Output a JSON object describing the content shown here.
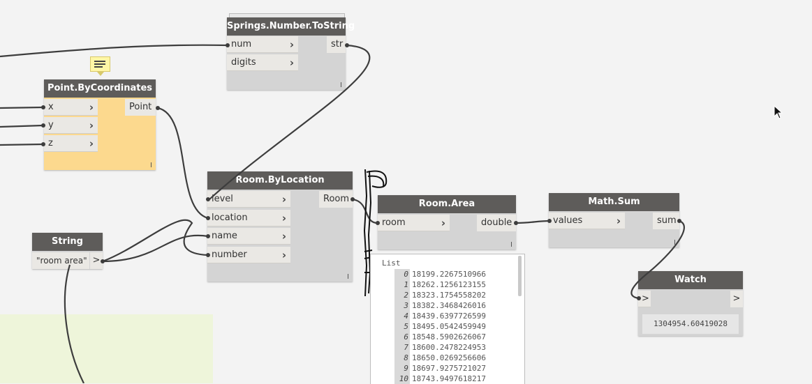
{
  "nodes": {
    "point": {
      "title": "Point.ByCoordinates",
      "inputs": [
        "x",
        "y",
        "z"
      ],
      "output": "Point"
    },
    "springs": {
      "title": "Springs.Number.ToString",
      "inputs": [
        "num",
        "digits"
      ],
      "output": "str"
    },
    "room_by_location": {
      "title": "Room.ByLocation",
      "inputs": [
        "level",
        "location",
        "name",
        "number"
      ],
      "output": "Room"
    },
    "string": {
      "title": "String",
      "value": "\"room area\"",
      "out_chevron": ">"
    },
    "room_area": {
      "title": "Room.Area",
      "input": "room",
      "output": "double"
    },
    "math_sum": {
      "title": "Math.Sum",
      "input": "values",
      "output": "sum"
    },
    "watch": {
      "title": "Watch",
      "in_chevron": ">",
      "out_chevron": ">",
      "value": "1304954.60419028"
    }
  },
  "preview": {
    "title": "List",
    "items": [
      {
        "index": "0",
        "value": "18199.2267510966"
      },
      {
        "index": "1",
        "value": "18262.1256123155"
      },
      {
        "index": "2",
        "value": "18323.1754558202"
      },
      {
        "index": "3",
        "value": "18382.3468426016"
      },
      {
        "index": "4",
        "value": "18439.6397726599"
      },
      {
        "index": "5",
        "value": "18495.0542459949"
      },
      {
        "index": "6",
        "value": "18548.5902626067"
      },
      {
        "index": "7",
        "value": "18600.2478224953"
      },
      {
        "index": "8",
        "value": "18650.0269256606"
      },
      {
        "index": "9",
        "value": "18697.9275721027"
      },
      {
        "index": "10",
        "value": "18743.9497618217"
      }
    ]
  },
  "chevron": "›",
  "colors": {
    "canvas": "#f3f3f3",
    "node_header": "#5e5c5a",
    "node_body": "#d4d4d4",
    "port": "#eae8e4",
    "selected_node": "#fcd98e",
    "group": "#eef5da",
    "wire": "#3d3d3d"
  }
}
